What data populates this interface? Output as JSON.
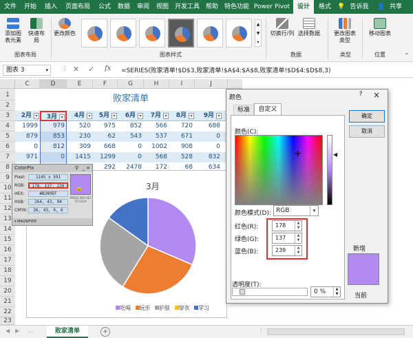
{
  "ribbon_tabs": [
    "文件",
    "开始",
    "插入",
    "页面布局",
    "公式",
    "数据",
    "审阅",
    "视图",
    "开发工具",
    "帮助",
    "特色功能",
    "Power Pivot",
    "设计",
    "格式",
    "告诉我",
    "共享"
  ],
  "ribbon": {
    "add_chart_element": "添加图表元素",
    "quick_layout": "快速布局",
    "change_colors": "更改颜色",
    "group_layout": "图表布局",
    "group_styles": "图表样式",
    "switch_row_col": "切换行/列",
    "select_data": "选择数据",
    "group_data": "数据",
    "change_type": "更改图表类型",
    "group_type": "类型",
    "move_chart": "移动图表",
    "group_location": "位置"
  },
  "formula_bar": {
    "name_box": "图表 3",
    "fx": "fx",
    "formula": "=SERIES(败家清单!$D$3,败家清单!$A$4:$A$8,败家清单!$D$4:$D$8,3)"
  },
  "sheet": {
    "columns": [
      "C",
      "D",
      "E",
      "F",
      "G",
      "H",
      "I",
      "J"
    ],
    "title": "败家清单",
    "rows": [
      "1",
      "2",
      "3",
      "4",
      "5",
      "6",
      "7",
      "8",
      "9",
      "10",
      "11",
      "12",
      "13",
      "14",
      "15",
      "16",
      "17",
      "18",
      "19",
      "20",
      "21",
      "22",
      "23"
    ],
    "headers": [
      "2月",
      "3月",
      "4月",
      "5月",
      "6月",
      "7月",
      "8月",
      "9月"
    ],
    "data": [
      [
        "1999",
        "979",
        "520",
        "975",
        "852",
        "566",
        "720",
        "688"
      ],
      [
        "879",
        "853",
        "230",
        "62",
        "543",
        "537",
        "671",
        "0"
      ],
      [
        "0",
        "812",
        "309",
        "668",
        "0",
        "1002",
        "908",
        "0"
      ],
      [
        "971",
        "0",
        "1415",
        "1299",
        "0",
        "568",
        "528",
        "832"
      ],
      [
        "0",
        "471",
        "0",
        "292",
        "2478",
        "172",
        "68",
        "634"
      ]
    ]
  },
  "chart": {
    "title": "3月",
    "legend": [
      "吃喝",
      "玩乐",
      "护肤",
      "穿衣",
      "学习"
    ]
  },
  "chart_data": {
    "type": "pie",
    "title": "3月",
    "categories": [
      "吃喝",
      "玩乐",
      "护肤",
      "穿衣",
      "学习"
    ],
    "values": [
      979,
      853,
      812,
      0,
      471
    ],
    "colors": [
      "#B289EF",
      "#ED7D31",
      "#A5A5A5",
      "#FFC000",
      "#4472C4"
    ]
  },
  "colorpix": {
    "title": "ColorPix",
    "pixel_label": "Pixel:",
    "pixel": "1145 x 591",
    "rgb_label": "RGB:",
    "rgb": "178, 137, 239",
    "hex_label": "HEX:",
    "hex": "#B289EF",
    "hsb_label": "HSB:",
    "hsb": "264, 43, 94",
    "cmyk_label": "CMYK:",
    "cmyk": "26, 43, 0, 6",
    "lock_hint": "PRESS ANY KEY TO LOCK",
    "magnifier": "MAGNIFIER",
    "swatch_color": "#B289EF"
  },
  "dialog": {
    "title": "颜色",
    "tab_standard": "标准",
    "tab_custom": "自定义",
    "colors_label": "颜色(C):",
    "ok": "确定",
    "cancel": "取消",
    "model_label": "颜色模式(D):",
    "model_value": "RGB",
    "red_label": "红色(R):",
    "red": "178",
    "green_label": "绿色(G):",
    "green": "137",
    "blue_label": "蓝色(B):",
    "blue": "239",
    "new_label": "新增",
    "current_label": "当前",
    "transparency_label": "透明度(T):",
    "transparency": "0 %",
    "help": "?",
    "close": "×"
  },
  "bottom": {
    "sheet_tab": "败家清单"
  },
  "colors": {
    "accent": "#217346",
    "highlight_red": "#E03131"
  }
}
